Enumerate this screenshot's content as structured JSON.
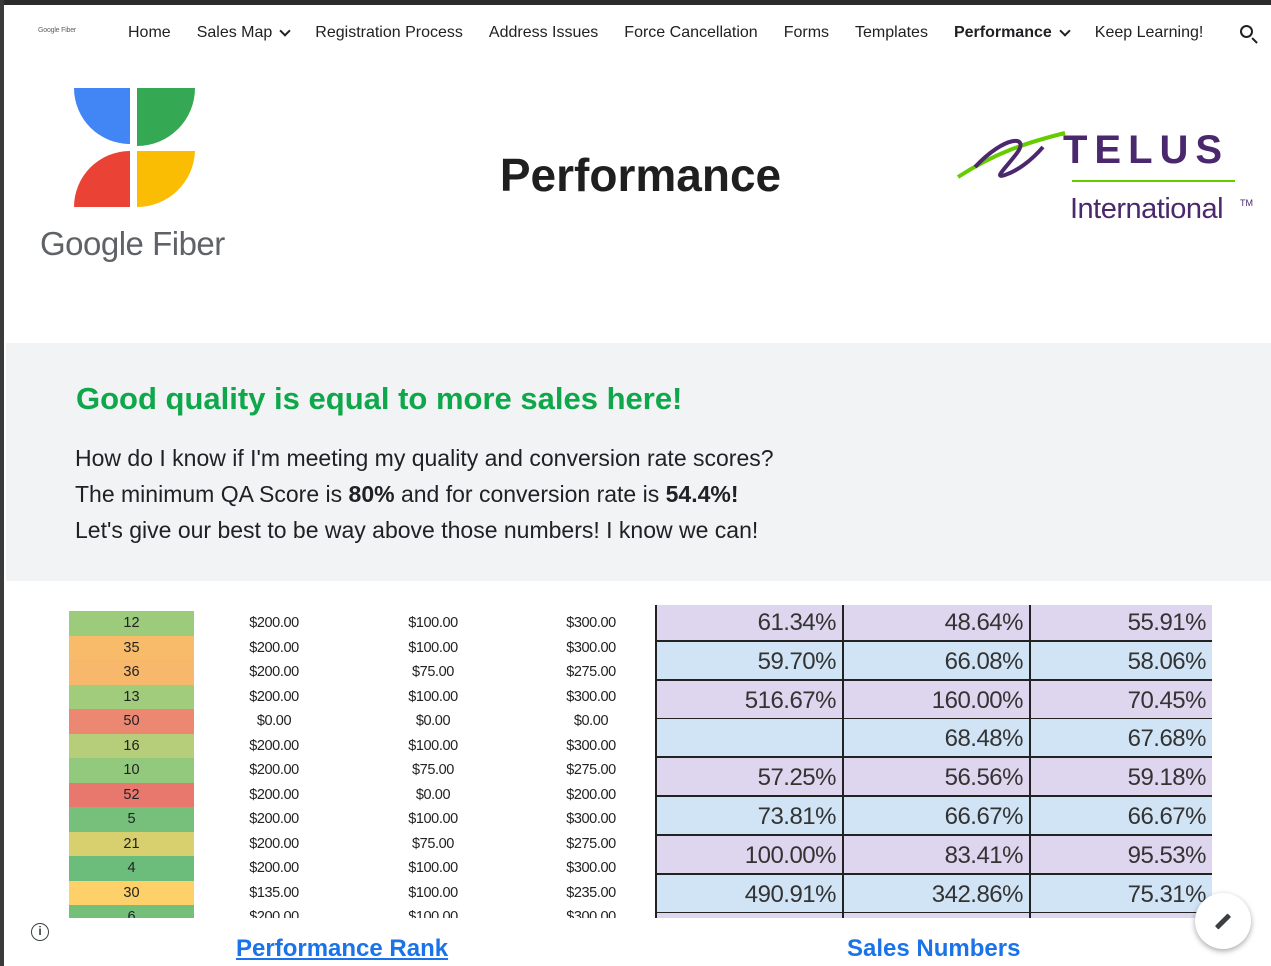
{
  "nav": {
    "logo_small": "Google Fiber",
    "items": [
      {
        "label": "Home",
        "dropdown": false,
        "active": false
      },
      {
        "label": "Sales Map",
        "dropdown": true,
        "active": false
      },
      {
        "label": "Registration Process",
        "dropdown": false,
        "active": false
      },
      {
        "label": "Address Issues",
        "dropdown": false,
        "active": false
      },
      {
        "label": "Force Cancellation",
        "dropdown": false,
        "active": false
      },
      {
        "label": "Forms",
        "dropdown": false,
        "active": false
      },
      {
        "label": "Templates",
        "dropdown": false,
        "active": false
      },
      {
        "label": "Performance",
        "dropdown": true,
        "active": true
      },
      {
        "label": "Keep Learning!",
        "dropdown": false,
        "active": false
      }
    ],
    "search_icon": "search-icon"
  },
  "header": {
    "title": "Performance",
    "google_fiber_logo_text": "Google Fiber",
    "telus_name": "TELUS",
    "telus_sub": "International",
    "telus_tm": "TM"
  },
  "quality": {
    "heading": "Good quality is equal to more sales here!",
    "line1": "How do I know if I'm meeting my quality and conversion rate scores?",
    "line2_prefix": "The minimum QA Score is ",
    "qa_min": "80%",
    "line2_mid": " and for conversion rate is ",
    "conv_min": "54.4%!",
    "line3": "Let's give our best to be way above those numbers! I know we can!"
  },
  "rank_table": {
    "rows": [
      {
        "rank": "12",
        "color": "#9ccb7c",
        "a": "$200.00",
        "b": "$100.00",
        "c": "$300.00"
      },
      {
        "rank": "35",
        "color": "#f8bb6a",
        "a": "$200.00",
        "b": "$100.00",
        "c": "$300.00"
      },
      {
        "rank": "36",
        "color": "#f8b86b",
        "a": "$200.00",
        "b": "$75.00",
        "c": "$275.00"
      },
      {
        "rank": "13",
        "color": "#a0cc7c",
        "a": "$200.00",
        "b": "$100.00",
        "c": "$300.00"
      },
      {
        "rank": "50",
        "color": "#ec8872",
        "a": "$0.00",
        "b": "$0.00",
        "c": "$0.00"
      },
      {
        "rank": "16",
        "color": "#b6cd79",
        "a": "$200.00",
        "b": "$100.00",
        "c": "$300.00"
      },
      {
        "rank": "10",
        "color": "#93c97d",
        "a": "$200.00",
        "b": "$75.00",
        "c": "$275.00"
      },
      {
        "rank": "52",
        "color": "#e8776e",
        "a": "$200.00",
        "b": "$0.00",
        "c": "$200.00"
      },
      {
        "rank": "5",
        "color": "#76c07c",
        "a": "$200.00",
        "b": "$100.00",
        "c": "$300.00"
      },
      {
        "rank": "21",
        "color": "#d8d06e",
        "a": "$200.00",
        "b": "$75.00",
        "c": "$275.00"
      },
      {
        "rank": "4",
        "color": "#6cbd7b",
        "a": "$200.00",
        "b": "$100.00",
        "c": "$300.00"
      },
      {
        "rank": "30",
        "color": "#fdd06a",
        "a": "$135.00",
        "b": "$100.00",
        "c": "$235.00"
      },
      {
        "rank": "6",
        "color": "#74c07b",
        "a": "$200.00",
        "b": "$100.00",
        "c": "$300.00"
      }
    ]
  },
  "sales_table": {
    "rows": [
      {
        "a": "61.34%",
        "b": "48.64%",
        "c": "55.91%",
        "bg": "#ddd6ee"
      },
      {
        "a": "59.70%",
        "b": "66.08%",
        "c": "58.06%",
        "bg": "#d1e4f6"
      },
      {
        "a": "516.67%",
        "b": "160.00%",
        "c": "70.45%",
        "bg": "#ddd6ee"
      },
      {
        "a": "",
        "b": "68.48%",
        "c": "67.68%",
        "bg": "#d1e4f6"
      },
      {
        "a": "57.25%",
        "b": "56.56%",
        "c": "59.18%",
        "bg": "#ddd6ee"
      },
      {
        "a": "73.81%",
        "b": "66.67%",
        "c": "66.67%",
        "bg": "#d1e4f6"
      },
      {
        "a": "100.00%",
        "b": "83.41%",
        "c": "95.53%",
        "bg": "#ddd6ee"
      },
      {
        "a": "490.91%",
        "b": "342.86%",
        "c": "75.31%",
        "bg": "#d1e4f6"
      },
      {
        "a": "",
        "b": "",
        "c": "",
        "bg": "#ddd6ee"
      }
    ]
  },
  "links": {
    "rank": "Performance Rank",
    "sales": "Sales Numbers"
  },
  "fab": {
    "info_icon": "info-icon",
    "info_glyph": "i",
    "edit_icon": "edit-icon"
  },
  "colors": {
    "accent_green": "#0fa74b",
    "link_blue": "#1a73e8",
    "telus_purple": "#4b286d"
  }
}
